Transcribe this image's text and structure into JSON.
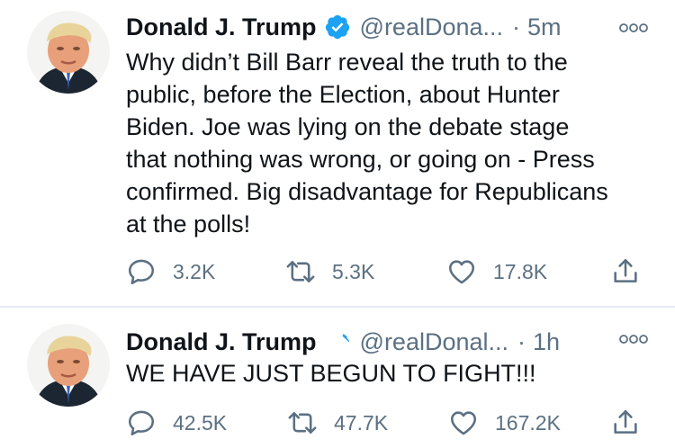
{
  "tweets": [
    {
      "author": {
        "name": "Donald J. Trump",
        "handle": "@realDona...",
        "verified": true
      },
      "time": "5m",
      "separator": "·",
      "text": "Why didn’t Bill Barr reveal the truth to the\npublic, before the Election, about Hunter\nBiden. Joe was lying on the debate stage\nthat nothing was wrong, or going on - Press\nconfirmed. Big disadvantage for Republicans\nat the polls!",
      "stats": {
        "replies": "3.2K",
        "retweets": "5.3K",
        "likes": "17.8K"
      }
    },
    {
      "author": {
        "name": "Donald J. Trump",
        "handle": "@realDonal...",
        "verified": true
      },
      "time": "1h",
      "separator": "·",
      "text": "WE HAVE JUST BEGUN TO FIGHT!!!",
      "stats": {
        "replies": "42.5K",
        "retweets": "47.7K",
        "likes": "167.2K"
      }
    }
  ],
  "icons": {
    "verified": "verified-badge-icon",
    "reply": "reply-icon",
    "retweet": "retweet-icon",
    "like": "heart-icon",
    "share": "share-icon",
    "more": "more-icon"
  },
  "colors": {
    "text": "#0f1419",
    "secondary": "#5b7083",
    "verified": "#1da1f2",
    "divider": "#e6ecf0"
  }
}
